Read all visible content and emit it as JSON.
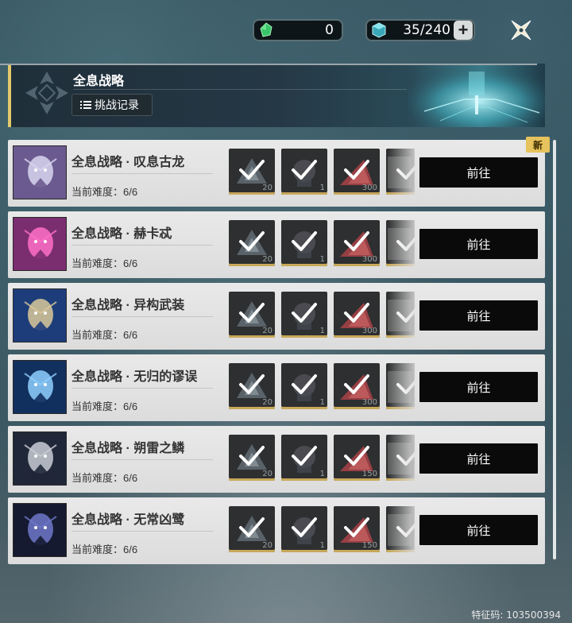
{
  "currency": {
    "item_a": {
      "value": "0",
      "icon": "green-crystal-icon"
    },
    "item_b": {
      "value": "35/240",
      "icon": "cyan-cube-icon",
      "plus_label": "+"
    }
  },
  "banner": {
    "title": "全息战略",
    "record_button": "挑战记录",
    "accent_color": "#e2c86a"
  },
  "new_badge": "新",
  "difficulty_label": "当前难度：",
  "go_label": "前往",
  "cards": [
    {
      "title": "全息战略 · 叹息古龙",
      "difficulty": "6/6",
      "rewards": [
        "20",
        "1",
        "300"
      ],
      "portrait_colors": [
        "#6b5a8f",
        "#d8d6ef"
      ]
    },
    {
      "title": "全息战略 · 赫卡忒",
      "difficulty": "6/6",
      "rewards": [
        "20",
        "1",
        "300"
      ],
      "portrait_colors": [
        "#7a2e6f",
        "#ff6fc8"
      ]
    },
    {
      "title": "全息战略 · 异构武装",
      "difficulty": "6/6",
      "rewards": [
        "20",
        "1",
        "300"
      ],
      "portrait_colors": [
        "#1d3d7a",
        "#d9c89a"
      ]
    },
    {
      "title": "全息战略 · 无归的谬误",
      "difficulty": "6/6",
      "rewards": [
        "20",
        "1",
        "300"
      ],
      "portrait_colors": [
        "#12305e",
        "#8fd0ff"
      ]
    },
    {
      "title": "全息战略 · 朔雷之鳞",
      "difficulty": "6/6",
      "rewards": [
        "20",
        "1",
        "150"
      ],
      "portrait_colors": [
        "#202738",
        "#c9ccd6"
      ]
    },
    {
      "title": "全息战略 · 无常凶鹭",
      "difficulty": "6/6",
      "rewards": [
        "20",
        "1",
        "150"
      ],
      "portrait_colors": [
        "#151a30",
        "#6f78c9"
      ]
    }
  ],
  "footer_id": "特征码: 103500394"
}
